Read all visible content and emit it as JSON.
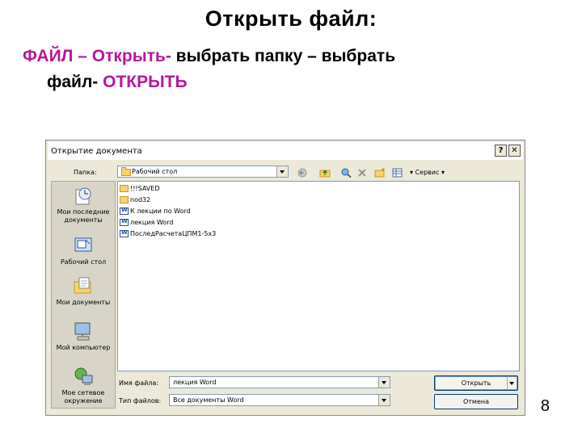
{
  "slide": {
    "title": "Открыть файл:",
    "instruction_part1": "ФАЙЛ – Открыть- ",
    "instruction_part2": "выбрать папку – выбрать",
    "instruction_part3": "файл- ",
    "instruction_part4": "ОТКРЫТЬ",
    "page_number": "8",
    "accent_color": "#b5179e"
  },
  "dialog": {
    "title": "Открытие документа",
    "help_button": "?",
    "close_button": "✕",
    "folder_label": "Папка:",
    "folder_value": "Рабочий стол",
    "toolbar_service": "Сервис",
    "toolbar_icons": [
      "back-icon",
      "up-folder-icon",
      "search-web-icon",
      "delete-icon",
      "new-folder-icon",
      "views-icon"
    ],
    "places": [
      {
        "label": "Мои последние документы",
        "icon": "recent-documents-icon"
      },
      {
        "label": "Рабочий стол",
        "icon": "desktop-icon"
      },
      {
        "label": "Мои документы",
        "icon": "my-documents-icon"
      },
      {
        "label": "Мой компьютер",
        "icon": "my-computer-icon"
      },
      {
        "label": "Мое сетевое окружение",
        "icon": "network-icon"
      }
    ],
    "files": [
      {
        "name": "!!!SAVED",
        "type": "folder"
      },
      {
        "name": "nod32",
        "type": "folder"
      },
      {
        "name": "К лекции по Word",
        "type": "word"
      },
      {
        "name": "лекция Word",
        "type": "word"
      },
      {
        "name": "ПоследРасчетаЦПМ1-5х3",
        "type": "word"
      }
    ],
    "filename_label": "Имя файла:",
    "filename_value": "лекция Word",
    "filetype_label": "Тип файлов:",
    "filetype_value": "Все документы Word",
    "open_button": "Открыть",
    "cancel_button": "Отмена"
  }
}
